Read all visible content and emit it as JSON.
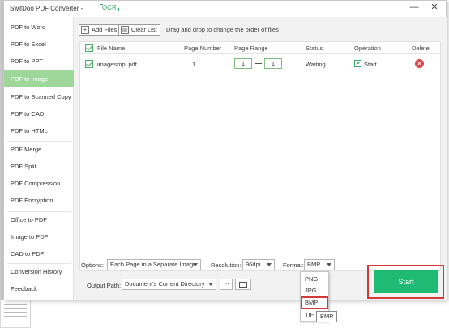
{
  "window": {
    "title": "SwifDoo PDF Converter -",
    "tag": "OCR",
    "minimize": "—",
    "close": "✕"
  },
  "sidebar": {
    "items": [
      {
        "label": "PDF to Word",
        "active": false
      },
      {
        "label": "PDF to Excel",
        "active": false
      },
      {
        "label": "PDF to PPT",
        "active": false
      },
      {
        "label": "PDF to Image",
        "active": true
      },
      {
        "label": "PDF to Scanned Copy",
        "active": false
      },
      {
        "label": "PDF to CAD",
        "active": false
      },
      {
        "label": "PDF to HTML",
        "active": false
      },
      {
        "label": "PDF Merge",
        "active": false
      },
      {
        "label": "PDF Split",
        "active": false
      },
      {
        "label": "PDF Compression",
        "active": false
      },
      {
        "label": "PDF Encryption",
        "active": false
      },
      {
        "label": "Office to PDF",
        "active": false
      },
      {
        "label": "Image to PDF",
        "active": false
      },
      {
        "label": "CAD to PDF",
        "active": false
      },
      {
        "label": "Conversion History",
        "active": false
      },
      {
        "label": "Feedback",
        "active": false
      }
    ]
  },
  "toolbar": {
    "add_files": "Add Files",
    "clear_list": "Clear List",
    "drag_hint": "Drag and drop to change the order of files"
  },
  "table": {
    "columns": [
      "File Name",
      "Page Number",
      "Page Range",
      "Status",
      "Operation",
      "Delete"
    ],
    "rows": [
      {
        "file_name": "imagesmpl.pdf",
        "page_number": "1",
        "range_from": "1",
        "range_to": "1",
        "status": "Waiting",
        "operation": "Start"
      }
    ]
  },
  "options": {
    "options_label": "Options:",
    "options_value": "Each Page in a Separate Image",
    "resolution_label": "Resolution:",
    "resolution_value": "96dpi",
    "format_label": "Format:",
    "format_value": "BMP",
    "output_label": "Output Path:",
    "output_value": "Document's Current Directory",
    "more_label": "···"
  },
  "format_dropdown": {
    "items": [
      "PNG",
      "JPG",
      "BMP",
      "TIF"
    ],
    "highlighted": "BMP",
    "tooltip": "BMP"
  },
  "start_button": "Start",
  "colors": {
    "accent": "#1fbb74",
    "active_sidebar": "#9fd69a",
    "highlight_border": "#d23a3a",
    "delete": "#e04848"
  }
}
